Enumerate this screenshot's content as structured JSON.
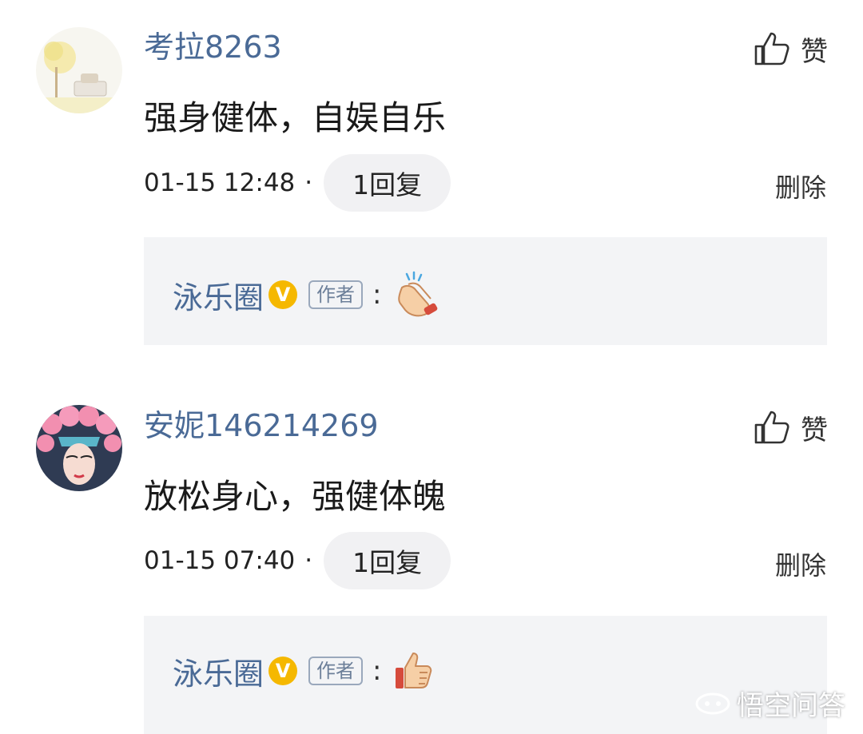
{
  "comments": [
    {
      "username": "考拉8263",
      "like_label": "赞",
      "text": "强身健体，自娱自乐",
      "timestamp": "01-15 12:48",
      "separator": "·",
      "reply_count_label": "1回复",
      "delete_label": "删除",
      "avatar": "avatar-illustration",
      "reply": {
        "author": "泳乐圈",
        "verified_badge": "V",
        "author_tag": "作者",
        "colon": ":",
        "emoji": "clapping-hands-emoji"
      }
    },
    {
      "username": "安妮146214269",
      "like_label": "赞",
      "text": "放松身心，强健体魄",
      "timestamp": "01-15 07:40",
      "separator": "·",
      "reply_count_label": "1回复",
      "delete_label": "删除",
      "avatar": "avatar-opera-headdress",
      "reply": {
        "author": "泳乐圈",
        "verified_badge": "V",
        "author_tag": "作者",
        "colon": ":",
        "emoji": "thumbs-up-emoji"
      }
    }
  ],
  "watermark": {
    "text": "悟空问答",
    "icon": "wukong-logo-icon"
  },
  "colors": {
    "username": "#4a6a96",
    "reply_box_bg": "#f3f4f6",
    "pill_bg": "#f1f1f3",
    "verified_badge": "#f5b800"
  }
}
